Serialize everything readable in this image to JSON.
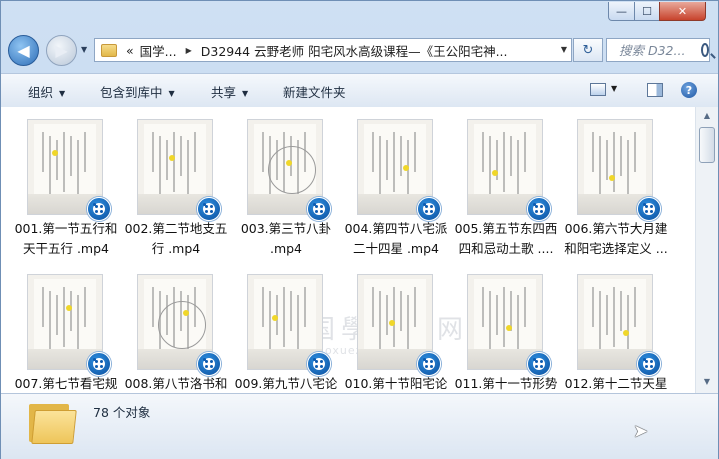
{
  "window": {
    "controls": {
      "minimize": "—",
      "maximize": "☐",
      "close": "✕"
    }
  },
  "nav": {
    "back_glyph": "◀",
    "forward_glyph": "▶",
    "breadcrumb_prefix": "«",
    "breadcrumbs": [
      "国学...",
      "D32944  云野老师 阳宅风水高级课程—《王公阳宅神..."
    ],
    "refresh_glyph": "↻",
    "search_placeholder": "搜索 D32..."
  },
  "toolbar": {
    "organize": "组织",
    "include_library": "包含到库中",
    "share": "共享",
    "new_folder": "新建文件夹"
  },
  "files": [
    {
      "name": "001.第一节五行和天干五行 .mp4"
    },
    {
      "name": "002.第二节地支五行 .mp4"
    },
    {
      "name": "003.第三节八卦 .mp4"
    },
    {
      "name": "004.第四节八宅派二十四星 .mp4"
    },
    {
      "name": "005.第五节东四西四和忌动土歌 ...."
    },
    {
      "name": "006.第六节大月建和阳宅选择定义 ..."
    },
    {
      "name": "007.第七节看宅规"
    },
    {
      "name": "008.第八节洛书和"
    },
    {
      "name": "009.第九节八宅论"
    },
    {
      "name": "010.第十节阳宅论"
    },
    {
      "name": "011.第十一节形势"
    },
    {
      "name": "012.第十二节天星"
    }
  ],
  "file_captions": [
    [
      "001.第一节五行和",
      "天干五行 .mp4"
    ],
    [
      "002.第二节地支五",
      "行 .mp4"
    ],
    [
      "003.第三节八卦",
      ".mp4"
    ],
    [
      "004.第四节八宅派",
      "二十四星 .mp4"
    ],
    [
      "005.第五节东四西",
      "四和忌动土歌 ...."
    ],
    [
      "006.第六节大月建",
      "和阳宅选择定义 ..."
    ],
    [
      "007.第七节看宅规"
    ],
    [
      "008.第八节洛书和"
    ],
    [
      "009.第九节八宅论"
    ],
    [
      "010.第十节阳宅论"
    ],
    [
      "011.第十一节形势"
    ],
    [
      "012.第十二节天星"
    ]
  ],
  "watermark": {
    "line1": "国學资源网",
    "line2": "guoxueziyuan.com"
  },
  "status": {
    "count_text": "78 个对象"
  }
}
